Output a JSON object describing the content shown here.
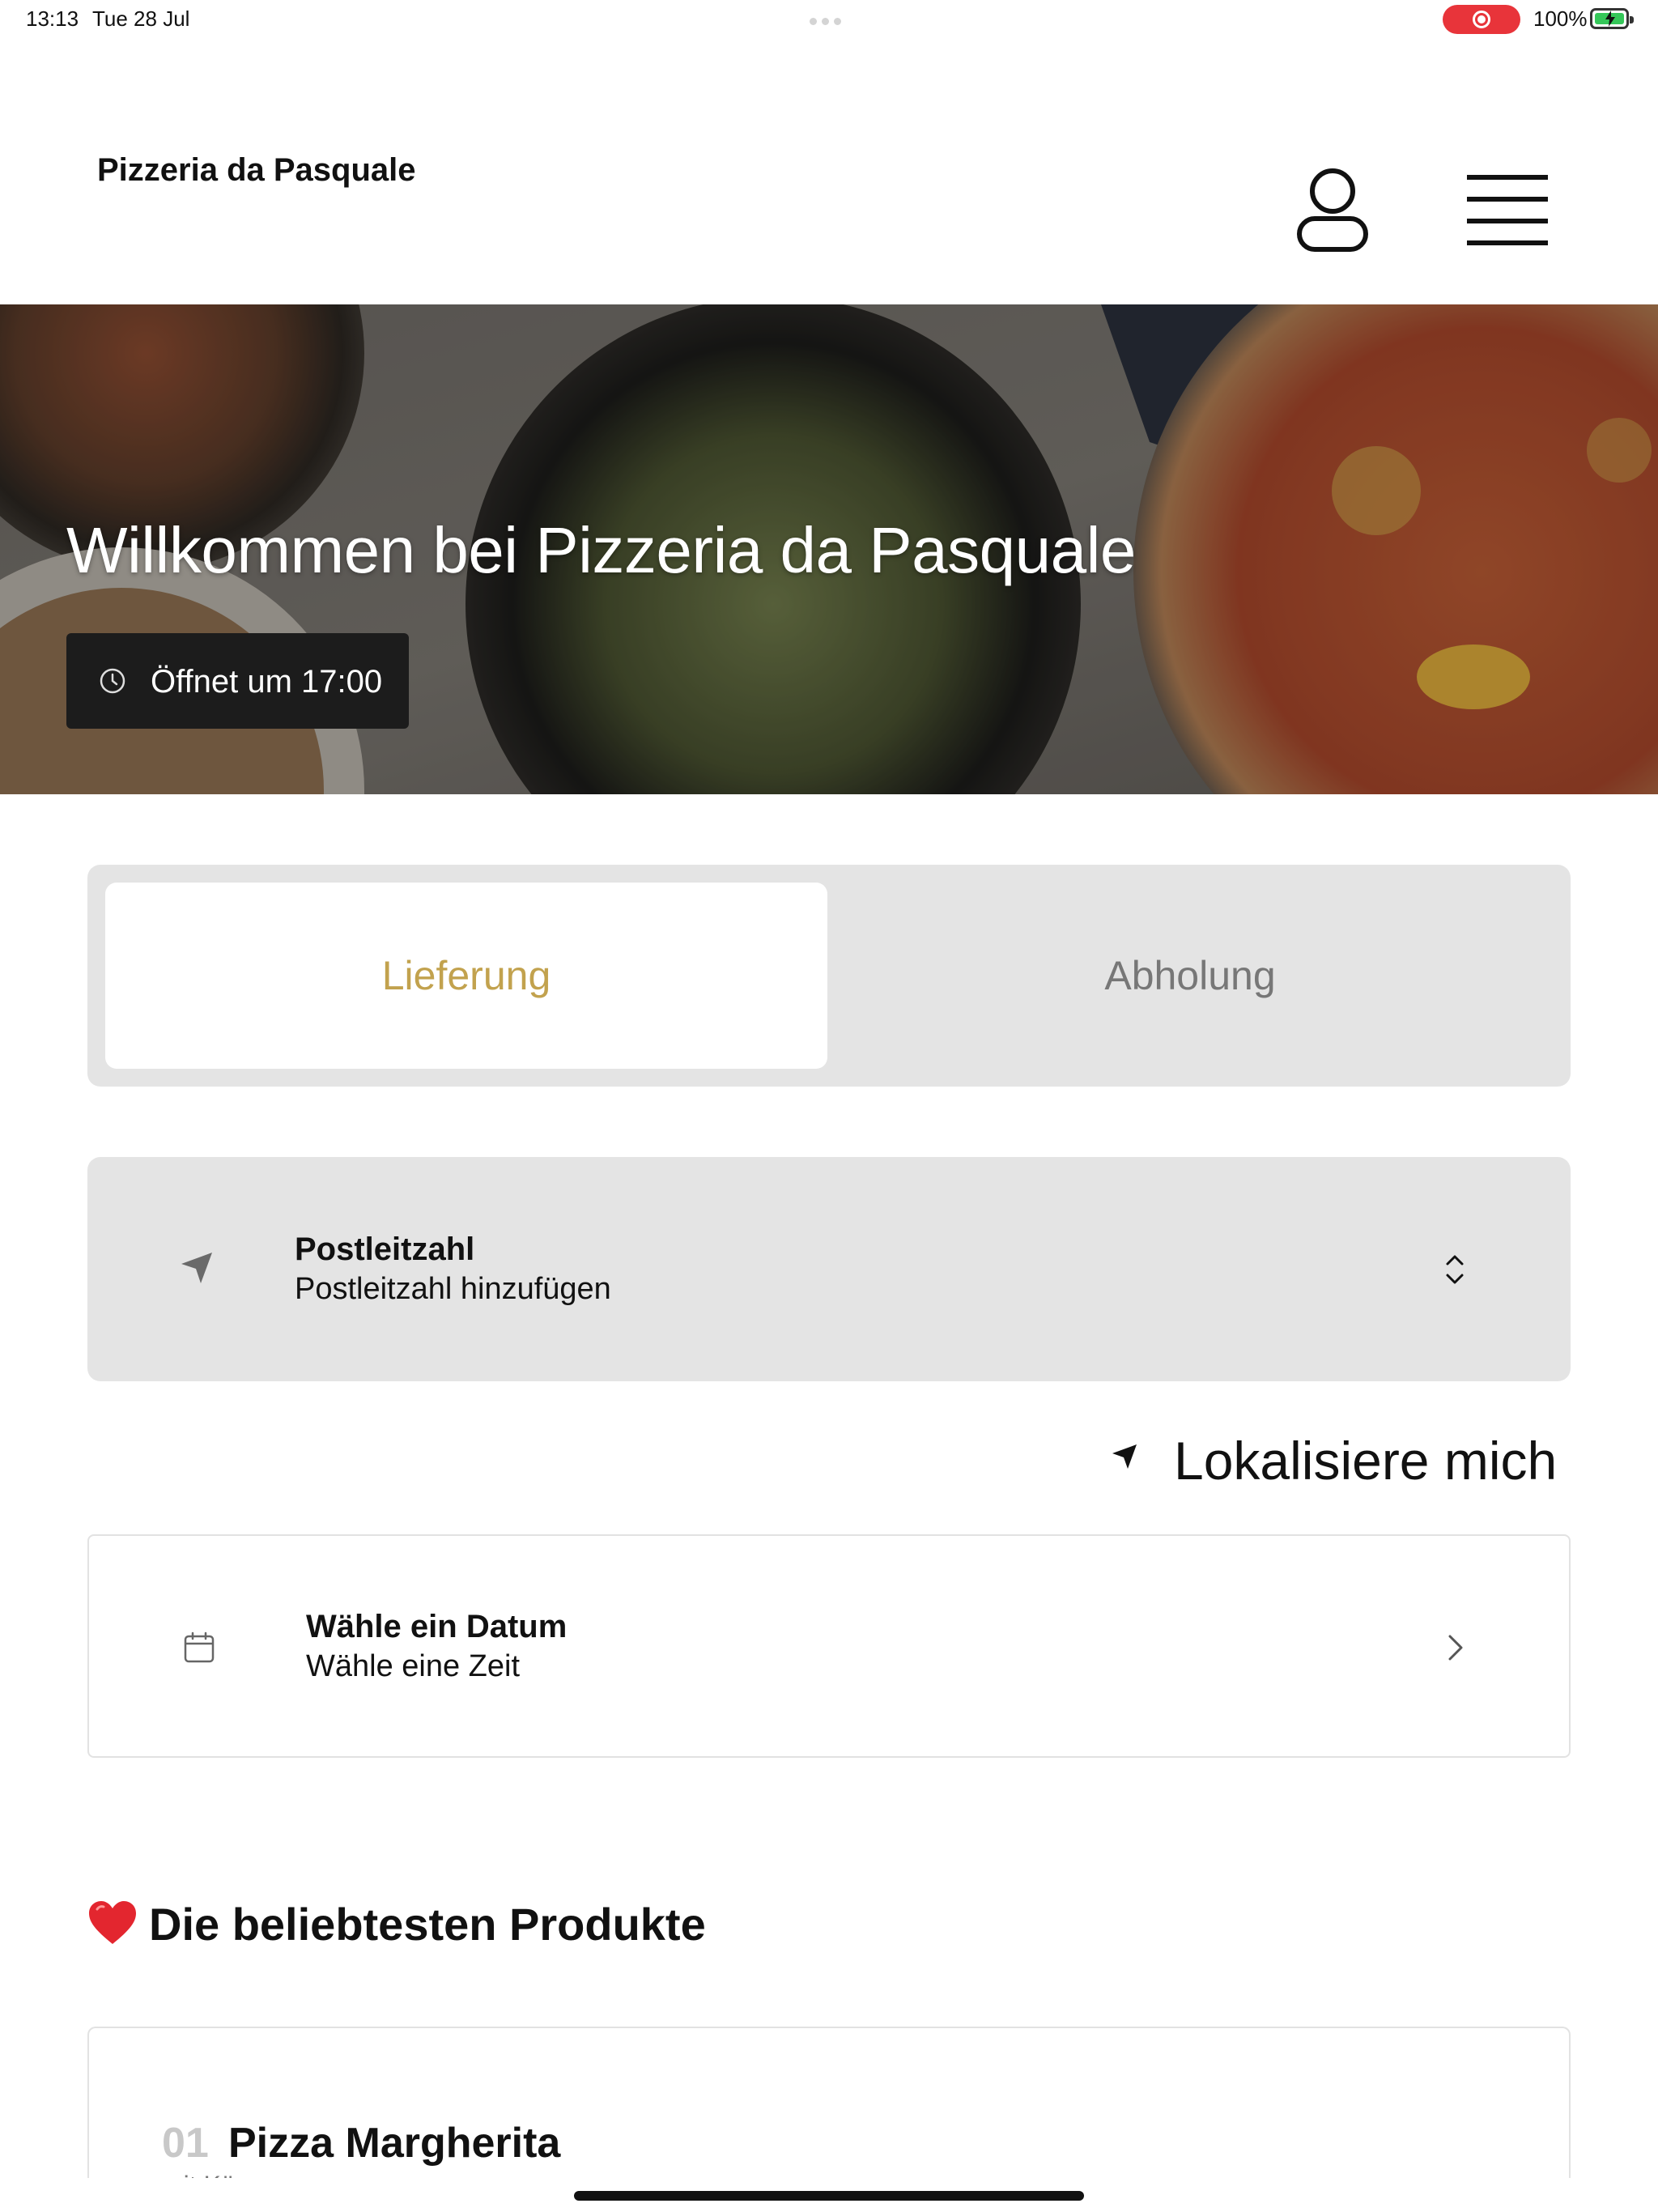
{
  "status_bar": {
    "time": "13:13",
    "date": "Tue 28 Jul",
    "battery_percent": "100%",
    "battery_level": 1.0,
    "recording_color": "#e8343a"
  },
  "header": {
    "brand": "Pizzeria da Pasquale",
    "user_icon": "person-icon",
    "menu_icon": "hamburger-menu-icon"
  },
  "hero": {
    "title": "Willkommen bei Pizzeria da Pasquale",
    "hours_icon": "clock-icon",
    "hours_text": "Öffnet um 17:00"
  },
  "order_mode": {
    "options": [
      "Lieferung",
      "Abholung"
    ],
    "selected": "Lieferung",
    "accent_color": "#c2a24e"
  },
  "postcode": {
    "icon": "location-arrow-icon",
    "label": "Postleitzahl",
    "value": "Postleitzahl hinzufügen",
    "trailing_icon": "chevron-up-down-icon"
  },
  "locate": {
    "icon": "location-arrow-icon",
    "label": "Lokalisiere mich"
  },
  "schedule": {
    "icon": "calendar-icon",
    "label": "Wähle ein Datum",
    "value": "Wähle eine Zeit",
    "trailing_icon": "chevron-right-icon"
  },
  "popular": {
    "icon": "heart-icon",
    "title": "Die beliebtesten Produkte",
    "products": [
      {
        "number": "01",
        "name": "Pizza Margherita",
        "subtitle": "mit Käse"
      }
    ]
  }
}
